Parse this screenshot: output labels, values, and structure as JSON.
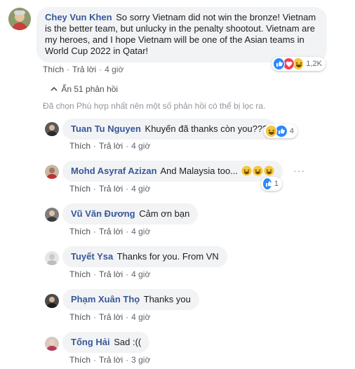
{
  "main_comment": {
    "author": "Chey Vun Khen",
    "text": "So sorry Vietnam did not win the bronze! Vietnam is the better team, but unlucky in the penalty shootout. Vietnam are my heroes, and I hope Vietnam will be one of the Asian teams in World Cup 2022 in Qatar!",
    "like_label": "Thích",
    "reply_label": "Trả lời",
    "time": "4 giờ",
    "reaction_count": "1,2K"
  },
  "hide_replies": {
    "label": "Ẩn 51 phản hồi"
  },
  "filter_note": "Đã chọn Phù hợp nhất nên một số phản hồi có thể bị lọc ra.",
  "replies": [
    {
      "author": "Tuan Tu Nguyen",
      "text": "Khuyến đã thanks còn you???",
      "like_label": "Thích",
      "reply_label": "Trả lời",
      "time": "4 giờ",
      "reaction_count": "4"
    },
    {
      "author": "Mohd Asyraf Azizan",
      "text": "And Malaysia too...",
      "like_label": "Thích",
      "reply_label": "Trả lời",
      "time": "4 giờ",
      "reaction_count": "1"
    },
    {
      "author": "Vũ Văn Đương",
      "text": "Cảm ơn bạn",
      "like_label": "Thích",
      "reply_label": "Trả lời",
      "time": "4 giờ"
    },
    {
      "author": "Tuyết Ysa",
      "text": "Thanks for you. From VN",
      "like_label": "Thích",
      "reply_label": "Trả lời",
      "time": "4 giờ"
    },
    {
      "author": "Phạm Xuân Thọ",
      "text": "Thanks you",
      "like_label": "Thích",
      "reply_label": "Trả lời",
      "time": "4 giờ"
    },
    {
      "author": "Tống Hải",
      "text": "Sad :((",
      "like_label": "Thích",
      "reply_label": "Trả lời",
      "time": "3 giờ"
    }
  ],
  "colors": {
    "author": "#385898",
    "bubble": "#f2f3f5",
    "meta": "#606770",
    "like_blue": "#2d88ff",
    "haha_yellow": "#f7c63b"
  }
}
